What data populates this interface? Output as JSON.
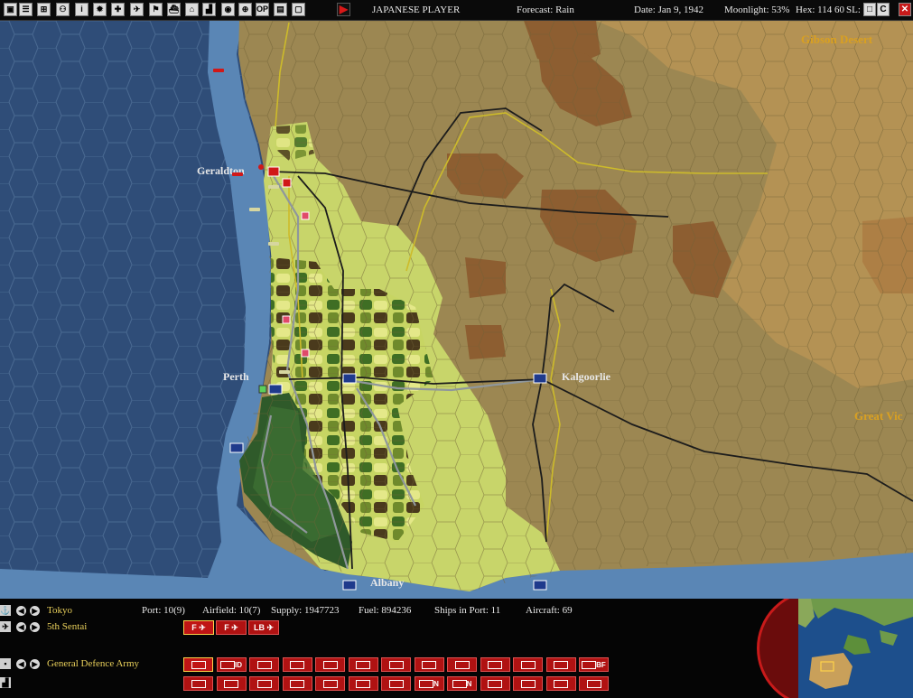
{
  "toolbar": {
    "buttons": [
      {
        "name": "save-icon",
        "glyph": "▣"
      },
      {
        "name": "reports-icon",
        "glyph": "☰"
      },
      {
        "name": "group-icon",
        "glyph": "⊞"
      },
      {
        "name": "task-force-icon",
        "glyph": "⚇"
      },
      {
        "name": "info-icon",
        "glyph": "i"
      },
      {
        "name": "sun-icon",
        "glyph": "✹"
      },
      {
        "name": "ground-unit-icon",
        "glyph": "✚"
      },
      {
        "name": "plane-icon",
        "glyph": "✈"
      },
      {
        "name": "flag-icon",
        "glyph": "⚑"
      },
      {
        "name": "ship-icon",
        "glyph": "⛴"
      },
      {
        "name": "production-icon",
        "glyph": "⌂"
      },
      {
        "name": "chart-icon",
        "glyph": "▟"
      },
      {
        "name": "map-icon",
        "glyph": "◉"
      },
      {
        "name": "globe-icon",
        "glyph": "⊕"
      },
      {
        "name": "op-icon",
        "glyph": "OP"
      },
      {
        "name": "terrain-icon",
        "glyph": "▤"
      },
      {
        "name": "window-icon",
        "glyph": "▢"
      }
    ],
    "end_turn_glyph": "▶",
    "player": "JAPANESE PLAYER",
    "forecast": "Forecast: Rain",
    "date": "Date: Jan 9, 1942",
    "moonlight": "Moonlight: 53%",
    "hex": "Hex: 114 60",
    "sl": "SL: 1",
    "window_buttons": [
      "□",
      "C",
      "✕"
    ]
  },
  "map": {
    "places": {
      "geraldton": "Geraldton",
      "perth": "Perth",
      "kalgoorlie": "Kalgoorlie",
      "albany": "Albany",
      "gibson": "Gibson Desert",
      "great_victoria": "Great Vic"
    }
  },
  "panel": {
    "base": "Tokyo",
    "unit": "5th Sentai",
    "army": "General Defence Army",
    "port": "Port: 10(9)",
    "airfield": "Airfield: 10(7)",
    "supply": "Supply: 1947723",
    "fuel": "Fuel: 894236",
    "ships": "Ships in Port: 11",
    "aircraft": "Aircraft: 69",
    "air_buttons": [
      {
        "label": "F",
        "name": "fighter-button"
      },
      {
        "label": "F",
        "name": "fighter-alt-button"
      },
      {
        "label": "LB",
        "name": "level-bomber-button"
      }
    ],
    "row1_buttons": [
      "",
      "ID",
      "",
      "",
      "",
      "",
      "",
      "",
      "",
      "",
      "",
      "",
      "BF"
    ],
    "row2_buttons": [
      "",
      "",
      "",
      "",
      "",
      "",
      "",
      "N",
      "N",
      "",
      "",
      "",
      ""
    ]
  },
  "colors": {
    "ocean": "#2f4d78",
    "coast": "#5a86b5",
    "desert": "#9c8752",
    "farmland": "#c8d56a",
    "allied_flag": "#1f3a8c",
    "japan_red": "#d01818",
    "button_red": "#b01212"
  }
}
